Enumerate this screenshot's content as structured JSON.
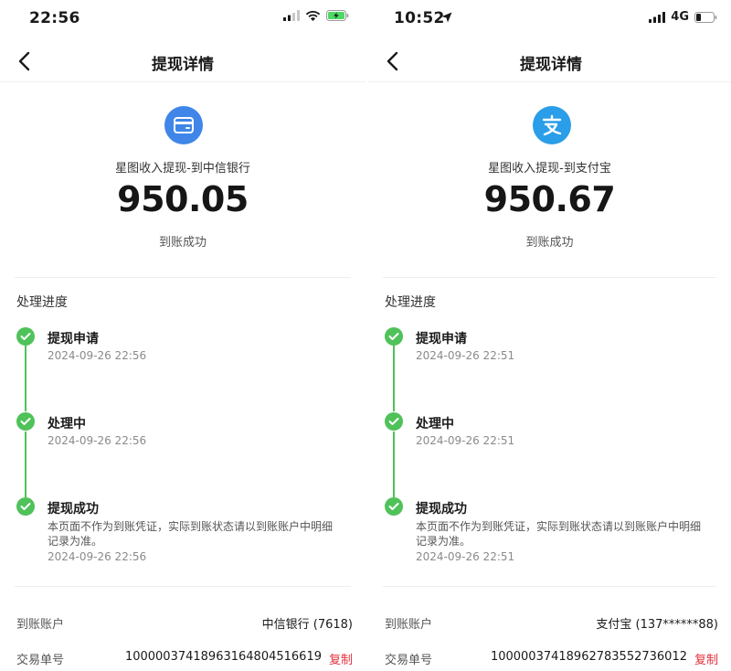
{
  "screens": [
    {
      "status": {
        "time": "22:56",
        "network": ""
      },
      "nav": {
        "title": "提现详情"
      },
      "hero": {
        "icon": "bank-card-icon",
        "icon_color": "#3f86e8",
        "subtitle": "星图收入提现-到中信银行",
        "amount": "950.05",
        "state": "到账成功"
      },
      "progress": {
        "title": "处理进度",
        "steps": [
          {
            "label": "提现申请",
            "time": "2024-09-26 22:56"
          },
          {
            "label": "处理中",
            "time": "2024-09-26 22:56"
          },
          {
            "label": "提现成功",
            "note": "本页面不作为到账凭证，实际到账状态请以到账账户中明细记录为准。",
            "time": "2024-09-26 22:56"
          }
        ]
      },
      "details": {
        "account_label": "到账账户",
        "account_value": "中信银行 (7618)",
        "order_label": "交易单号",
        "order_value": "1000003741896316480451​6619",
        "copy_label": "复制"
      }
    },
    {
      "status": {
        "time": "10:52",
        "network": "4G"
      },
      "nav": {
        "title": "提现详情"
      },
      "hero": {
        "icon": "alipay-icon",
        "icon_color": "#2a9ee8",
        "subtitle": "星图收入提现-到支付宝",
        "amount": "950.67",
        "state": "到账成功"
      },
      "progress": {
        "title": "处理进度",
        "steps": [
          {
            "label": "提现申请",
            "time": "2024-09-26 22:51"
          },
          {
            "label": "处理中",
            "time": "2024-09-26 22:51"
          },
          {
            "label": "提现成功",
            "note": "本页面不作为到账凭证，实际到账状态请以到账账户中明细记录为准。",
            "time": "2024-09-26 22:51"
          }
        ]
      },
      "details": {
        "account_label": "到账账户",
        "account_value": "支付宝 (137******88)",
        "order_label": "交易单号",
        "order_value": "1000003741896278355273​6012",
        "copy_label": "复制"
      }
    }
  ],
  "colors": {
    "success": "#4fc25a",
    "copy": "#e0303a"
  }
}
